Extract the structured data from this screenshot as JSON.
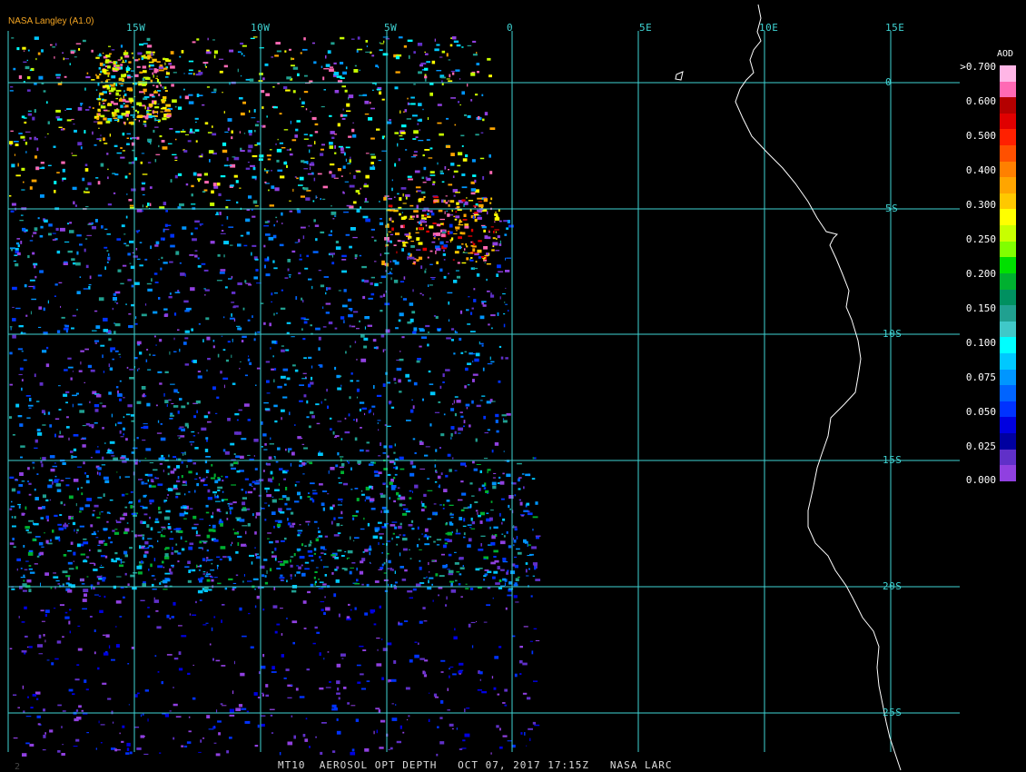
{
  "credit": "NASA Langley (A1.0)",
  "footer": {
    "frame_number": "2",
    "caption": "MT10  AEROSOL OPT DEPTH   OCT 07, 2017 17:15Z   NASA LARC"
  },
  "longitude_labels": [
    "15W",
    "10W",
    "5W",
    "0",
    "5E",
    "10E",
    "15E"
  ],
  "latitude_labels": [
    "0",
    "5S",
    "10S",
    "15S",
    "20S",
    "25S"
  ],
  "legend": {
    "title": "AOD",
    "labels": [
      ">0.700",
      "0.600",
      "0.500",
      "0.400",
      "0.300",
      "0.250",
      "0.200",
      "0.150",
      "0.100",
      "0.075",
      "0.050",
      "0.025",
      "0.000"
    ],
    "colors": [
      "#ffb6e6",
      "#ff69b4",
      "#b40000",
      "#e00000",
      "#ff2000",
      "#ff5000",
      "#ff8000",
      "#ffa500",
      "#ffc800",
      "#ffff00",
      "#c8ff00",
      "#80ff00",
      "#00e000",
      "#00b030",
      "#009060",
      "#20a090",
      "#40c8c8",
      "#00ffff",
      "#00c8ff",
      "#0096ff",
      "#0064ff",
      "#0032ff",
      "#0000e0",
      "#0000a0",
      "#6030c8",
      "#9040e0"
    ]
  },
  "colors": {
    "grid": "#3fd3d3",
    "coast": "#ffffff",
    "credit": "#f5a623",
    "background": "#000000"
  }
}
